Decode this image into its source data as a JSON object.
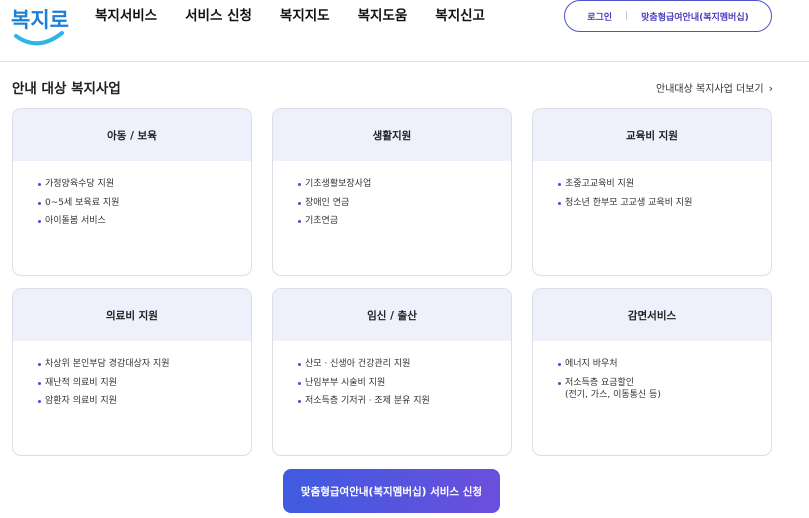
{
  "logo": {
    "text": "복지로",
    "color": "#1e7fd6",
    "smile_color": "#2fb4e6"
  },
  "nav": {
    "items": [
      "복지서비스",
      "서비스 신청",
      "복지지도",
      "복지도움",
      "복지신고"
    ]
  },
  "util": {
    "login": "로그인",
    "membership": "맞춤형급여안내(복지멤버십)"
  },
  "section": {
    "title": "안내 대상 복지사업",
    "more": "안내대상 복지사업 더보기"
  },
  "cards": [
    {
      "title": "아동 / 보육",
      "items": [
        "가정양육수당 지원",
        "0~5세 보육료 지원",
        "아이돌봄 서비스"
      ]
    },
    {
      "title": "생활지원",
      "items": [
        "기초생활보장사업",
        "장애인 연금",
        "기초연금"
      ]
    },
    {
      "title": "교육비 지원",
      "items": [
        "초중고교육비 지원",
        "청소년 한부모 고교생 교육비 지원"
      ]
    },
    {
      "title": "의료비 지원",
      "items": [
        "차상위 본인부담 경감대상자 지원",
        "재난적 의료비 지원",
        "암환자 의료비 지원"
      ]
    },
    {
      "title": "임신 / 출산",
      "items": [
        "산모 · 신생아 건강관리 지원",
        "난임부부 시술비 지원",
        "저소득층 기저귀 · 조제 분유 지원"
      ]
    },
    {
      "title": "감면서비스",
      "items": [
        "에너지 바우처",
        "저소득층 요금할인\n(전기, 가스, 이동통신 등)"
      ]
    }
  ],
  "apply_button": "맞춤형급여안내(복지멤버십) 서비스 신청",
  "colors": {
    "accent": "#4b3fbf",
    "card_head_bg": "#eef0fb",
    "button_gradient_start": "#3f5be0",
    "button_gradient_end": "#6b4fdc"
  }
}
